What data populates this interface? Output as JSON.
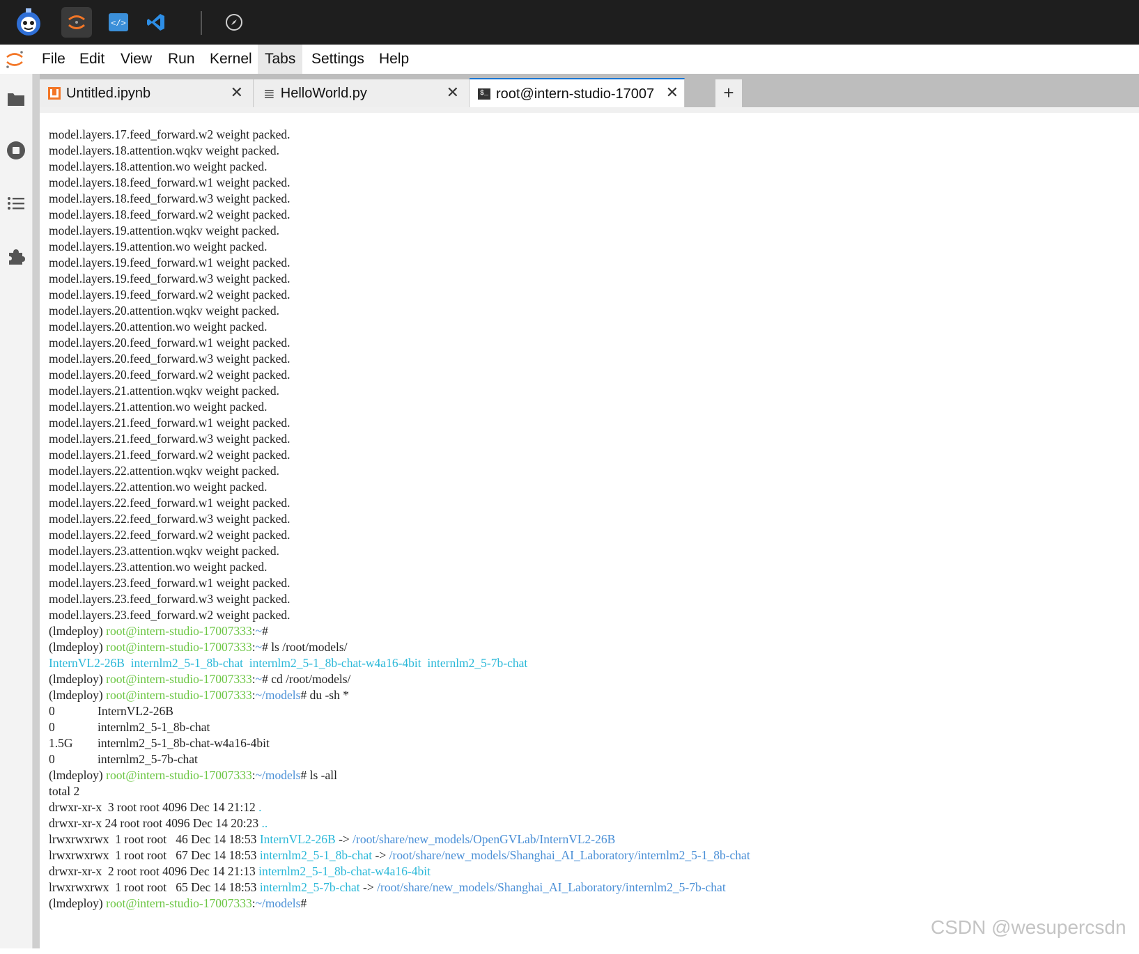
{
  "menu": [
    "File",
    "Edit",
    "View",
    "Run",
    "Kernel",
    "Tabs",
    "Settings",
    "Help"
  ],
  "tabs": [
    {
      "label": "Untitled.ipynb",
      "close": "✕"
    },
    {
      "label": "HelloWorld.py",
      "close": "✕"
    },
    {
      "label": "root@intern-studio-17007",
      "close": "✕"
    }
  ],
  "add_tab": "+",
  "icons": {
    "top": [
      "intern-logo-icon",
      "jupyter-icon",
      "code-editor-icon",
      "vscode-icon",
      "compass-icon"
    ],
    "left": [
      "folder-icon",
      "stop-circle-icon",
      "list-icon",
      "puzzle-icon"
    ]
  },
  "colors": {
    "prompt_user": "#6cc644",
    "path": "#4a8fd6",
    "link": "#2bb8d8",
    "tab_accent": "#1976d2"
  },
  "terminal": {
    "log_lines": [
      "model.layers.17.feed_forward.w2 weight packed.",
      "model.layers.18.attention.wqkv weight packed.",
      "model.layers.18.attention.wo weight packed.",
      "model.layers.18.feed_forward.w1 weight packed.",
      "model.layers.18.feed_forward.w3 weight packed.",
      "model.layers.18.feed_forward.w2 weight packed.",
      "model.layers.19.attention.wqkv weight packed.",
      "model.layers.19.attention.wo weight packed.",
      "model.layers.19.feed_forward.w1 weight packed.",
      "model.layers.19.feed_forward.w3 weight packed.",
      "model.layers.19.feed_forward.w2 weight packed.",
      "model.layers.20.attention.wqkv weight packed.",
      "model.layers.20.attention.wo weight packed.",
      "model.layers.20.feed_forward.w1 weight packed.",
      "model.layers.20.feed_forward.w3 weight packed.",
      "model.layers.20.feed_forward.w2 weight packed.",
      "model.layers.21.attention.wqkv weight packed.",
      "model.layers.21.attention.wo weight packed.",
      "model.layers.21.feed_forward.w1 weight packed.",
      "model.layers.21.feed_forward.w3 weight packed.",
      "model.layers.21.feed_forward.w2 weight packed.",
      "model.layers.22.attention.wqkv weight packed.",
      "model.layers.22.attention.wo weight packed.",
      "model.layers.22.feed_forward.w1 weight packed.",
      "model.layers.22.feed_forward.w3 weight packed.",
      "model.layers.22.feed_forward.w2 weight packed.",
      "model.layers.23.attention.wqkv weight packed.",
      "model.layers.23.attention.wo weight packed.",
      "model.layers.23.feed_forward.w1 weight packed.",
      "model.layers.23.feed_forward.w3 weight packed.",
      "model.layers.23.feed_forward.w2 weight packed."
    ],
    "env": "(lmdeploy) ",
    "user_host": "root@intern-studio-17007333",
    "colon": ":",
    "home": "~",
    "models_dir": "~/models",
    "p1_cmd": "#",
    "p2_cmd": "# ls /root/models/",
    "ls_items": [
      "InternVL2-26B",
      "internlm2_5-1_8b-chat",
      "internlm2_5-1_8b-chat-w4a16-4bit",
      "internlm2_5-7b-chat"
    ],
    "p3_cmd": "# cd /root/models/",
    "p4_cmd": "# du -sh *",
    "du_rows": [
      {
        "size": "0",
        "name": "InternVL2-26B"
      },
      {
        "size": "0",
        "name": "internlm2_5-1_8b-chat"
      },
      {
        "size": "1.5G",
        "name": "internlm2_5-1_8b-chat-w4a16-4bit"
      },
      {
        "size": "0",
        "name": "internlm2_5-7b-chat"
      }
    ],
    "p5_cmd": "# ls -all",
    "total": "total 2",
    "ls_all": [
      {
        "meta": "drwxr-xr-x  3 root root 4096 Dec 14 21:12 ",
        "name": ".",
        "arrow": "",
        "target": ""
      },
      {
        "meta": "drwxr-xr-x 24 root root 4096 Dec 14 20:23 ",
        "name": "..",
        "arrow": "",
        "target": ""
      },
      {
        "meta": "lrwxrwxrwx  1 root root   46 Dec 14 18:53 ",
        "name": "InternVL2-26B",
        "arrow": " -> ",
        "target": "/root/share/new_models/OpenGVLab/InternVL2-26B"
      },
      {
        "meta": "lrwxrwxrwx  1 root root   67 Dec 14 18:53 ",
        "name": "internlm2_5-1_8b-chat",
        "arrow": " -> ",
        "target": "/root/share/new_models/Shanghai_AI_Laboratory/internlm2_5-1_8b-chat"
      },
      {
        "meta": "drwxr-xr-x  2 root root 4096 Dec 14 21:13 ",
        "name": "internlm2_5-1_8b-chat-w4a16-4bit",
        "arrow": "",
        "target": ""
      },
      {
        "meta": "lrwxrwxrwx  1 root root   65 Dec 14 18:53 ",
        "name": "internlm2_5-7b-chat",
        "arrow": " -> ",
        "target": "/root/share/new_models/Shanghai_AI_Laboratory/internlm2_5-7b-chat"
      }
    ],
    "p6_cmd": "#"
  },
  "watermark": "CSDN @wesupercsdn"
}
